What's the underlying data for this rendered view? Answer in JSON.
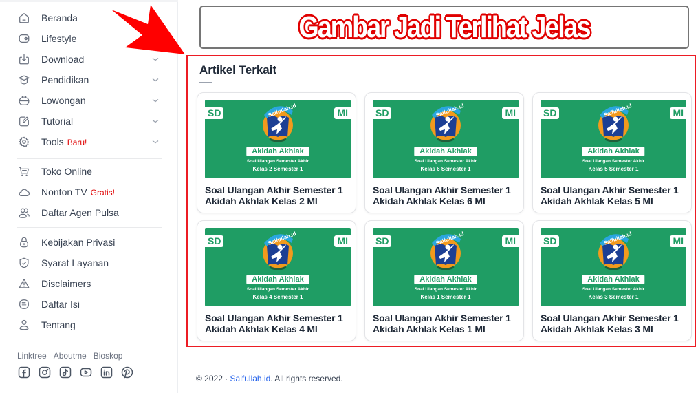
{
  "sidebar": {
    "group1": [
      {
        "label": "Beranda",
        "icon": "home-icon",
        "chevron": false,
        "badge": ""
      },
      {
        "label": "Lifestyle",
        "icon": "wallet-icon",
        "chevron": false,
        "badge": ""
      },
      {
        "label": "Download",
        "icon": "download-icon",
        "chevron": true,
        "badge": ""
      },
      {
        "label": "Pendidikan",
        "icon": "graduation-cap-icon",
        "chevron": true,
        "badge": ""
      },
      {
        "label": "Lowongan",
        "icon": "briefcase-icon",
        "chevron": true,
        "badge": ""
      },
      {
        "label": "Tutorial",
        "icon": "pencil-icon",
        "chevron": true,
        "badge": ""
      },
      {
        "label": "Tools",
        "icon": "gear-icon",
        "chevron": true,
        "badge": "Baru!"
      }
    ],
    "group2": [
      {
        "label": "Toko Online",
        "icon": "cart-icon",
        "badge": ""
      },
      {
        "label": "Nonton TV",
        "icon": "cloud-icon",
        "badge": "Gratis!"
      },
      {
        "label": "Daftar Agen Pulsa",
        "icon": "users-icon",
        "badge": ""
      }
    ],
    "group3": [
      {
        "label": "Kebijakan Privasi",
        "icon": "lock-icon"
      },
      {
        "label": "Syarat Layanan",
        "icon": "shield-check-icon"
      },
      {
        "label": "Disclaimers",
        "icon": "warning-icon"
      },
      {
        "label": "Daftar Isi",
        "icon": "list-icon"
      },
      {
        "label": "Tentang",
        "icon": "user-icon"
      }
    ],
    "footer_links": [
      "Linktree",
      "Aboutme",
      "Bioskop"
    ],
    "social": [
      "facebook-icon",
      "instagram-icon",
      "tiktok-icon",
      "youtube-icon",
      "linkedin-icon",
      "pinterest-icon"
    ]
  },
  "banner": {
    "text": "Gambar Jadi Terlihat Jelas"
  },
  "related": {
    "title": "Artikel Terkait",
    "cards": [
      {
        "title": "Soal Ulangan Akhir Semester 1 Akidah Akhlak Kelas 2 MI",
        "thumb_left": "SD",
        "thumb_right": "MI",
        "thumb_subject": "Akidah Akhlak",
        "thumb_sub1": "Soal Ulangan Semester Akhir",
        "thumb_sub2": "Kelas 2 Semester 1"
      },
      {
        "title": "Soal Ulangan Akhir Semester 1 Akidah Akhlak Kelas 6 MI",
        "thumb_left": "SD",
        "thumb_right": "MI",
        "thumb_subject": "Akidah Akhlak",
        "thumb_sub1": "Soal Ulangan Semester Akhir",
        "thumb_sub2": "Kelas 6 Semester 1"
      },
      {
        "title": "Soal Ulangan Akhir Semester 1 Akidah Akhlak Kelas 5 MI",
        "thumb_left": "SD",
        "thumb_right": "MI",
        "thumb_subject": "Akidah Akhlak",
        "thumb_sub1": "Soal Ulangan Semester Akhir",
        "thumb_sub2": "Kelas 5 Semester 1"
      },
      {
        "title": "Soal Ulangan Akhir Semester 1 Akidah Akhlak Kelas 4 MI",
        "thumb_left": "SD",
        "thumb_right": "MI",
        "thumb_subject": "Akidah Akhlak",
        "thumb_sub1": "Soal Ulangan Semester Akhir",
        "thumb_sub2": "Kelas 4 Semester 1"
      },
      {
        "title": "Soal Ulangan Akhir Semester 1 Akidah Akhlak Kelas 1 MI",
        "thumb_left": "SD",
        "thumb_right": "MI",
        "thumb_subject": "Akidah Akhlak",
        "thumb_sub1": "Soal Ulangan Semester Akhir",
        "thumb_sub2": "Kelas 1 Semester 1"
      },
      {
        "title": "Soal Ulangan Akhir Semester 1 Akidah Akhlak Kelas 3 MI",
        "thumb_left": "SD",
        "thumb_right": "MI",
        "thumb_subject": "Akidah Akhlak",
        "thumb_sub1": "Soal Ulangan Semester Akhir",
        "thumb_sub2": "Kelas 3 Semester 1"
      }
    ],
    "logo_text": "Saifullah.id"
  },
  "footer": {
    "prefix": "© 2022 · ",
    "site": "Saifullah.id",
    "suffix": ". All rights reserved."
  },
  "colors": {
    "accent_red": "#ec1c24",
    "thumb_green": "#1f9d64",
    "logo_orange": "#f29a1d",
    "logo_blue": "#1c3f94",
    "link_blue": "#2563eb",
    "badge_red": "#e00000"
  }
}
